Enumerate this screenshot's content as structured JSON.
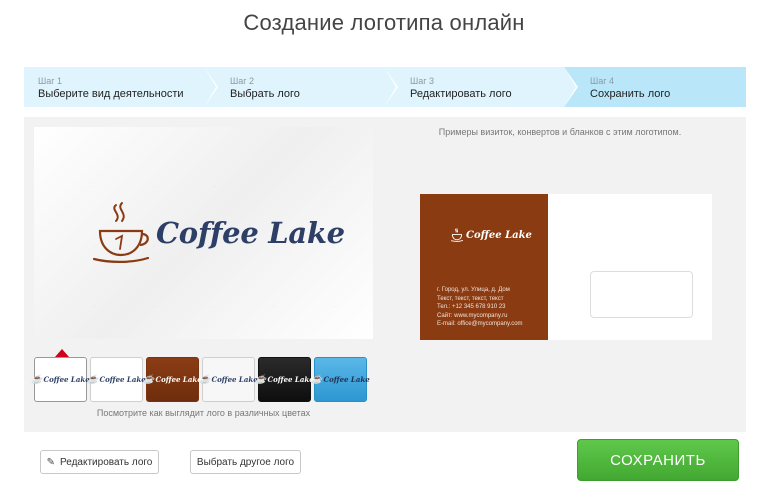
{
  "page": {
    "title": "Создание логотипа онлайн"
  },
  "steps": [
    {
      "num": "Шаг 1",
      "label": "Выберите вид деятельности"
    },
    {
      "num": "Шаг 2",
      "label": "Выбрать лого"
    },
    {
      "num": "Шаг 3",
      "label": "Редактировать лого"
    },
    {
      "num": "Шаг 4",
      "label": "Сохранить лого"
    }
  ],
  "preview": {
    "logo_text": "Coffee Lake",
    "swatches": [
      {
        "bg": "#ffffff",
        "text_color": "#2d3f66",
        "selected": true
      },
      {
        "bg": "#ffffff",
        "text_color": "#2d3f66",
        "selected": false
      },
      {
        "bg": "#7a3310",
        "text_color": "#ffffff",
        "selected": false
      },
      {
        "bg": "#f7f7f7",
        "text_color": "#2d3f66",
        "selected": false
      },
      {
        "bg": "#1a1a1a",
        "text_color": "#ffffff",
        "selected": false
      },
      {
        "bg": "#3aa6de",
        "text_color": "#2d3f66",
        "selected": false
      }
    ],
    "hint": "Посмотрите как выглядит лого в различных цветах"
  },
  "mockups": {
    "title": "Примеры визиток, конвертов и бланков с этим логотипом.",
    "card": {
      "logo_text": "Coffee Lake",
      "lines": [
        "г. Город, ул. Улица, д. Дом",
        "Текст, текст, текст, текст",
        "Тел.: +12 345 678 910 23",
        "Сайт: www.mycompany.ru",
        "E-mail: office@mycompany.com"
      ]
    }
  },
  "buttons": {
    "edit": "Редактировать лого",
    "other": "Выбрать другое лого",
    "save": "СОХРАНИТЬ"
  },
  "colors": {
    "accent_brown": "#8a3b12",
    "logo_blue": "#2d3f66",
    "save_green": "#4cb83a",
    "step_bg": "#dff4fd"
  }
}
